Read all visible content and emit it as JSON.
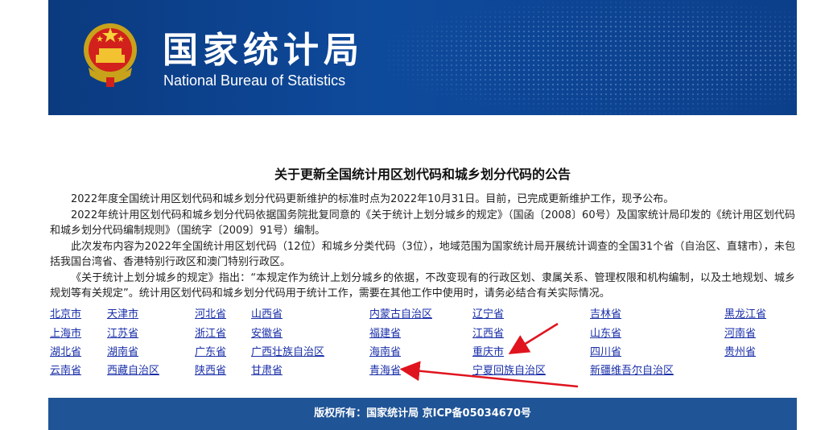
{
  "header": {
    "title_cn": "国家统计局",
    "title_en": "National Bureau of Statistics"
  },
  "article": {
    "headline": "关于更新全国统计用区划代码和城乡划分代码的公告",
    "paragraphs": [
      "2022年度全国统计用区划代码和城乡划分代码更新维护的标准时点为2022年10月31日。目前，已完成更新维护工作，现予公布。",
      "2022年统计用区划代码和城乡划分代码依据国务院批复同意的《关于统计上划分城乡的规定》（国函〔2008〕60号）及国家统计局印发的《统计用区划代码和城乡划分代码编制规则》（国统字〔2009〕91号）编制。",
      "此次发布内容为2022年全国统计用区划代码（12位）和城乡分类代码（3位），地域范围为国家统计局开展统计调查的全国31个省（自治区、直辖市），未包括我国台湾省、香港特别行政区和澳门特别行政区。",
      "《关于统计上划分城乡的规定》指出：“本规定作为统计上划分城乡的依据，不改变现有的行政区划、隶属关系、管理权限和机构编制，以及土地规划、城乡规划等有关规定”。统计用区划代码和城乡划分代码用于统计工作，需要在其他工作中使用时，请务必结合有关实际情况。"
    ]
  },
  "provinces": [
    [
      "北京市",
      "天津市",
      "河北省",
      "山西省",
      "内蒙古自治区",
      "辽宁省",
      "吉林省",
      "黑龙江省"
    ],
    [
      "上海市",
      "江苏省",
      "浙江省",
      "安徽省",
      "福建省",
      "江西省",
      "山东省",
      "河南省"
    ],
    [
      "湖北省",
      "湖南省",
      "广东省",
      "广西壮族自治区",
      "海南省",
      "重庆市",
      "四川省",
      "贵州省"
    ],
    [
      "云南省",
      "西藏自治区",
      "陕西省",
      "甘肃省",
      "青海省",
      "宁夏回族自治区",
      "新疆维吾尔自治区"
    ]
  ],
  "footer": {
    "text": "版权所有：国家统计局 京ICP备05034670号"
  },
  "colors": {
    "banner": "#0e4a9c",
    "footer": "#1f5496",
    "link": "#1a2fa8",
    "annotation_arrow": "#e0141e"
  }
}
